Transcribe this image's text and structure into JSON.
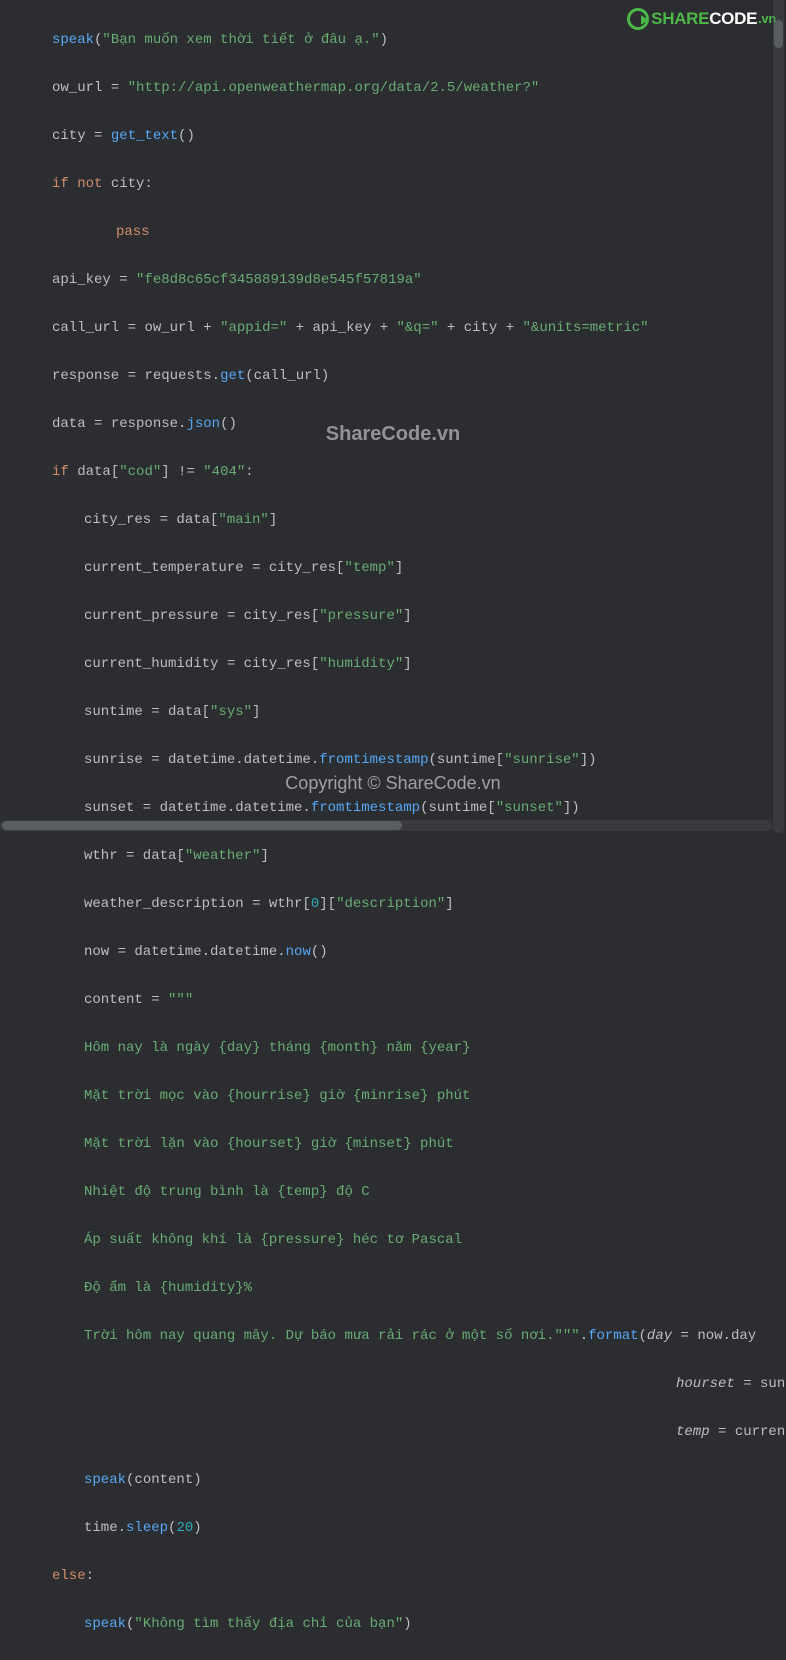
{
  "logo": {
    "share": "SHARE",
    "code": "CODE",
    "vn": ".vn"
  },
  "watermark_center": "ShareCode.vn",
  "watermark_copyright": "Copyright © ShareCode.vn",
  "code": {
    "l1_fn": "speak",
    "l1_p": "(",
    "l1_str": "\"Bạn muốn xem thời tiết ở đâu ạ.\"",
    "l1_cp": ")",
    "l2_id": "ow_url",
    "l2_eq": " = ",
    "l2_str": "\"http://api.openweathermap.org/data/2.5/weather?\"",
    "l3_id": "city",
    "l3_eq": " = ",
    "l3_fn": "get_text",
    "l3_p": "()",
    "l4_kw1": "if not ",
    "l4_id": "city",
    "l4_c": ":",
    "l5_kw": "pass",
    "l6_id": "api_key",
    "l6_eq": " = ",
    "l6_str": "\"fe8d8c65cf345889139d8e545f57819a\"",
    "l7_id": "call_url",
    "l7_eq": " = ",
    "l7_a": "ow_url + ",
    "l7_s1": "\"appid=\"",
    "l7_b": " + api_key + ",
    "l7_s2": "\"&q=\"",
    "l7_c": " + city + ",
    "l7_s3": "\"&units=metric\"",
    "l8_id": "response",
    "l8_eq": " = ",
    "l8_a": "requests.",
    "l8_fn": "get",
    "l8_p": "(call_url)",
    "l9_id": "data",
    "l9_eq": " = ",
    "l9_a": "response.",
    "l9_fn": "json",
    "l9_p": "()",
    "l10_kw": "if ",
    "l10_id": "data[",
    "l10_s": "\"cod\"",
    "l10_b": "] != ",
    "l10_s2": "\"404\"",
    "l10_c": ":",
    "l11_a": "city_res = data[",
    "l11_s": "\"main\"",
    "l11_b": "]",
    "l12_a": "current_temperature = city_res[",
    "l12_s": "\"temp\"",
    "l12_b": "]",
    "l13_a": "current_pressure = city_res[",
    "l13_s": "\"pressure\"",
    "l13_b": "]",
    "l14_a": "current_humidity = city_res[",
    "l14_s": "\"humidity\"",
    "l14_b": "]",
    "l15_a": "suntime = data[",
    "l15_s": "\"sys\"",
    "l15_b": "]",
    "l16_a": "sunrise = datetime.datetime.",
    "l16_fn": "fromtimestamp",
    "l16_b": "(suntime[",
    "l16_s": "\"sunrise\"",
    "l16_c": "])",
    "l17_a": "sunset = datetime.datetime.",
    "l17_fn": "fromtimestamp",
    "l17_b": "(suntime[",
    "l17_s": "\"sunset\"",
    "l17_c": "])",
    "l18_a": "wthr = data[",
    "l18_s": "\"weather\"",
    "l18_b": "]",
    "l19_a": "weather_description = wthr[",
    "l19_n": "0",
    "l19_b": "][",
    "l19_s": "\"description\"",
    "l19_c": "]",
    "l20_a": "now = datetime.datetime.",
    "l20_fn": "now",
    "l20_p": "()",
    "l21_a": "content = ",
    "l21_s": "\"\"\"",
    "l22": "Hôm nay là ngày {day} tháng {month} năm {year}",
    "l23": "Mặt trời mọc vào {hourrise} giờ {minrise} phút",
    "l24": "Mặt trời lặn vào {hourset} giờ {minset} phút",
    "l25": "Nhiệt độ trung bình là {temp} độ C",
    "l26": "Áp suất không khí là {pressure} héc tơ Pascal",
    "l27": "Độ ẩm là {humidity}%",
    "l28a": "Trời hôm nay quang mây. Dự báo mưa rải rác ở một số nơi.\"\"\"",
    "l28b": ".",
    "l28fn": "format",
    "l28c": "(",
    "l28p1": "day",
    "l28d": " = now.day",
    "l29p": "hourset",
    "l29d": " = sun",
    "l30p": "temp",
    "l30d": " = curren",
    "l31_fn": "speak",
    "l31_p": "(content)",
    "l32_a": "time.",
    "l32_fn": "sleep",
    "l32_b": "(",
    "l32_n": "20",
    "l32_c": ")",
    "l33_kw": "else",
    "l33_c": ":",
    "l34_fn": "speak",
    "l34_p": "(",
    "l34_s": "\"Không tìm thấy địa chỉ của bạn\"",
    "l34_c": ")"
  }
}
